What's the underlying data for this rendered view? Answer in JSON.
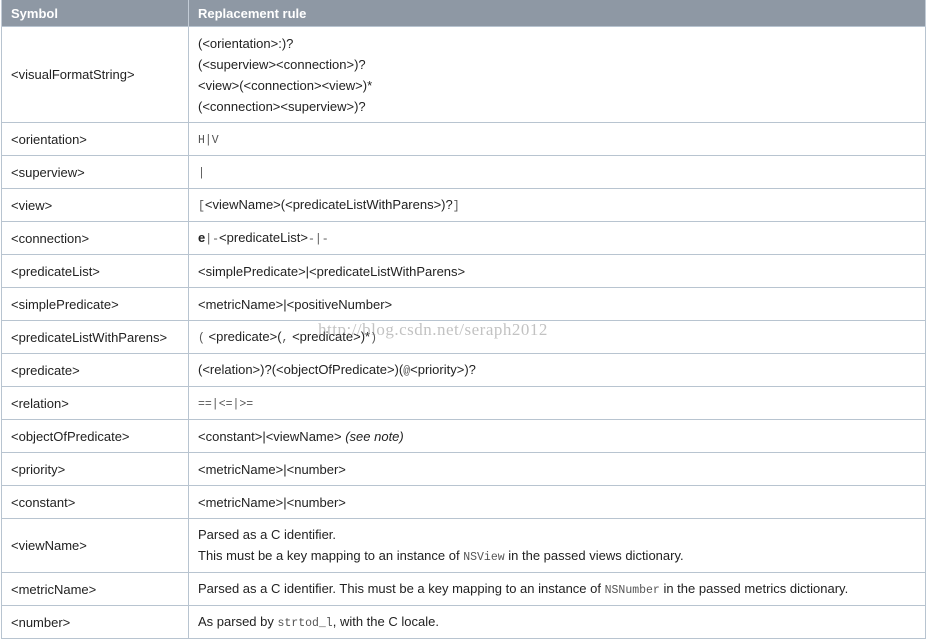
{
  "headers": {
    "symbol": "Symbol",
    "rule": "Replacement rule"
  },
  "rows": {
    "visualFormatString": {
      "symbol": "<visualFormatString>",
      "l1": "(<orientation>:)?",
      "l2": "(<superview><connection>)?",
      "l3": "<view>(<connection><view>)*",
      "l4": "(<connection><superview>)?"
    },
    "orientation": {
      "symbol": "<orientation>",
      "rule": "H|V"
    },
    "superview": {
      "symbol": "<superview>",
      "rule": "|"
    },
    "view": {
      "symbol": "<view>",
      "p1": "[",
      "p2": "<viewName>(<predicateListWithParens>)?",
      "p3": "]"
    },
    "connection": {
      "symbol": "<connection>",
      "p1": "e",
      "p2": "|-",
      "p3": "<predicateList>",
      "p4": "-|-"
    },
    "predicateList": {
      "symbol": "<predicateList>",
      "rule": "<simplePredicate>|<predicateListWithParens>"
    },
    "simplePredicate": {
      "symbol": "<simplePredicate>",
      "rule": "<metricName>|<positiveNumber>"
    },
    "predicateListWithParens": {
      "symbol": "<predicateListWithParens>",
      "p1": "(",
      "p2": "<predicate>(",
      "p3": ",",
      "p4": "<predicate>)*",
      "p5": ")"
    },
    "predicate": {
      "symbol": "<predicate>",
      "p1": "(<relation>)?(<objectOfPredicate>)(",
      "p2": "@",
      "p3": "<priority>)?"
    },
    "relation": {
      "symbol": "<relation>",
      "rule": "==|<=|>="
    },
    "objectOfPredicate": {
      "symbol": "<objectOfPredicate>",
      "p1": "<constant>|<viewName>",
      "note": "(see note)"
    },
    "priority": {
      "symbol": "<priority>",
      "rule": "<metricName>|<number>"
    },
    "constant": {
      "symbol": "<constant>",
      "rule": "<metricName>|<number>"
    },
    "viewName": {
      "symbol": "<viewName>",
      "l1": "Parsed as a C identifier.",
      "l2a": "This must be a key mapping to an instance of",
      "l2b": "NSView",
      "l2c": "in the passed views dictionary."
    },
    "metricName": {
      "symbol": "<metricName>",
      "a": "Parsed as a C identifier. This must be a key mapping to an instance of",
      "b": "NSNumber",
      "c": "in the passed metrics dictionary."
    },
    "number": {
      "symbol": "<number>",
      "a": "As parsed by",
      "b": "strtod_l",
      "c": ", with the C locale."
    }
  },
  "watermark": "http://blog.csdn.net/seraph2012"
}
